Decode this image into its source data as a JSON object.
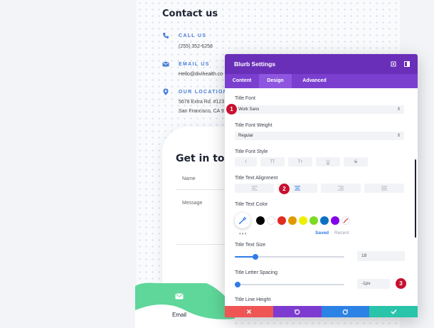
{
  "website": {
    "contact_title": "Contact us",
    "contacts": [
      {
        "icon": "phone-icon",
        "label": "CALL US",
        "lines": [
          "(255) 352-6258"
        ]
      },
      {
        "icon": "envelope-icon",
        "label": "EMAIL US",
        "lines": [
          "Hello@divihealth.co"
        ]
      },
      {
        "icon": "location-pin-icon",
        "label": "OUR LOCATION",
        "lines": [
          "5678 Extra Rd. #123",
          "San Francisco, CA 9"
        ]
      }
    ],
    "form_title": "Get in tou",
    "form_fields": [
      "Name",
      "Message"
    ],
    "email_tab_label": "Email",
    "accent_green": "#5fd79a"
  },
  "panel": {
    "title": "Blurb Settings",
    "tabs": [
      "Content",
      "Design",
      "Advanced"
    ],
    "active_tab": "Design",
    "title_font": {
      "label": "Title Font",
      "value": "Work Sans"
    },
    "title_font_weight": {
      "label": "Title Font Weight",
      "value": "Regular"
    },
    "title_font_style": {
      "label": "Title Font Style",
      "options": [
        "I",
        "TT",
        "Tт",
        "U",
        "S"
      ]
    },
    "title_text_alignment": {
      "label": "Title Text Alignment",
      "selected": "center"
    },
    "title_text_color": {
      "label": "Title Text Color",
      "swatches": [
        "#000000",
        "#ffffff",
        "#e02b20",
        "#e09900",
        "#edf000",
        "#7cda24",
        "#0c71c3",
        "#8300e9"
      ],
      "saved_label": "Saved",
      "recent_label": "Recent"
    },
    "title_text_size": {
      "label": "Title Text Size",
      "value": "18",
      "slider_fraction": 0.19
    },
    "title_letter_spacing": {
      "label": "Title Letter Spacing",
      "value": "-1px",
      "slider_fraction": 0.0
    },
    "title_line_height": {
      "label": "Title Line Height"
    },
    "colors": {
      "header": "#6a2fb8",
      "tabs": "#7b3fd0",
      "accent": "#2f7ce8"
    }
  },
  "footer": {
    "buttons": [
      {
        "name": "cancel",
        "icon": "close-icon",
        "color": "#ef5555"
      },
      {
        "name": "undo",
        "icon": "undo-icon",
        "color": "#7e3bd0"
      },
      {
        "name": "redo",
        "icon": "redo-icon",
        "color": "#2c82e5"
      },
      {
        "name": "save",
        "icon": "check-icon",
        "color": "#29c4a9"
      }
    ]
  },
  "markers": [
    "1",
    "2",
    "3"
  ]
}
